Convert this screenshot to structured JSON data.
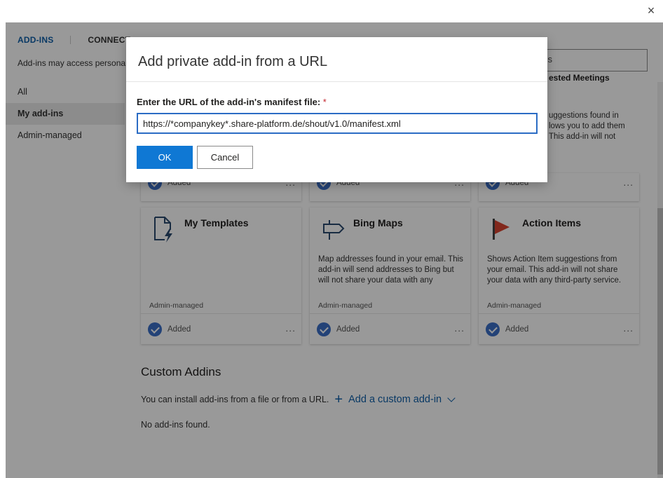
{
  "window": {
    "close_glyph": "×"
  },
  "nav": {
    "tabs": [
      {
        "label": "ADD-INS",
        "active": true
      },
      {
        "label": "CONNECT",
        "active": false
      }
    ],
    "privacy_note": "Add-ins may access personal",
    "items": [
      {
        "label": "All",
        "selected": false
      },
      {
        "label": "My add-ins",
        "selected": true
      },
      {
        "label": "Admin-managed",
        "selected": false
      }
    ]
  },
  "search": {
    "value": "-ins"
  },
  "background_cards_top": {
    "third_title_partial": "ested Meetings",
    "third_desc_lines": [
      "uggestions found in",
      "lows you to add them",
      "This add-in will not"
    ],
    "status": "Added",
    "more": "..."
  },
  "cards": [
    {
      "title": "My Templates",
      "icon": "template-lightning-icon",
      "description": "",
      "managed": "Admin-managed",
      "status": "Added",
      "more": "..."
    },
    {
      "title": "Bing Maps",
      "icon": "signpost-icon",
      "description": "Map addresses found in your email. This add-in will send addresses to Bing but will not share your data with any",
      "managed": "Admin-managed",
      "status": "Added",
      "more": "..."
    },
    {
      "title": "Action Items",
      "icon": "red-flag-icon",
      "description": "Shows Action Item suggestions from your email. This add-in will not share your data with any third-party service.",
      "managed": "Admin-managed",
      "status": "Added",
      "more": "..."
    }
  ],
  "custom": {
    "title": "Custom Addins",
    "install_text": "You can install add-ins from a file or from a URL.",
    "add_plus": "+",
    "add_label": "Add a custom add-in",
    "empty": "No add-ins found."
  },
  "dialog": {
    "title": "Add private add-in from a URL",
    "field_label": "Enter the URL of the add-in's manifest file:",
    "required_mark": "*",
    "url_value": "https://*companykey*.share-platform.de/shout/v1.0/manifest.xml",
    "ok_label": "OK",
    "cancel_label": "Cancel"
  },
  "colors": {
    "accent": "#0f78d4",
    "link": "#0f5fa8",
    "check": "#3b6fc7",
    "flag": "#d9442f"
  }
}
